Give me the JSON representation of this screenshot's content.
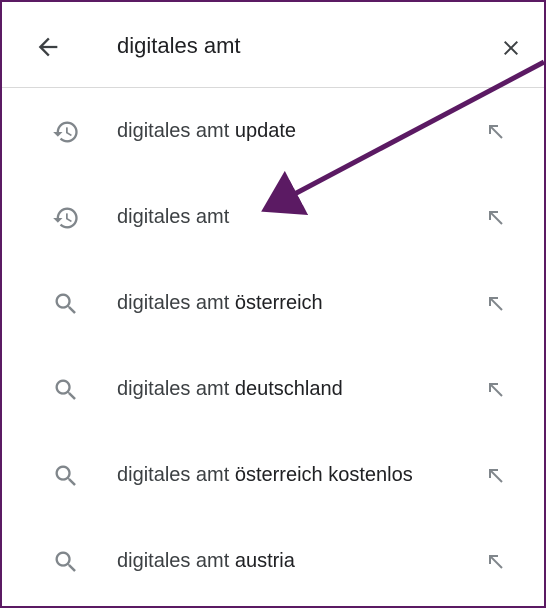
{
  "search": {
    "query": "digitales amt",
    "back_icon": "arrow-back-icon",
    "clear_icon": "close-icon"
  },
  "suggestions": [
    {
      "type": "history",
      "icon": "history-icon",
      "prefix": "digitales amt",
      "suffix": " update"
    },
    {
      "type": "history",
      "icon": "history-icon",
      "prefix": "digitales amt",
      "suffix": ""
    },
    {
      "type": "search",
      "icon": "search-icon",
      "prefix": "digitales amt",
      "suffix": " österreich"
    },
    {
      "type": "search",
      "icon": "search-icon",
      "prefix": "digitales amt",
      "suffix": " deutschland"
    },
    {
      "type": "search",
      "icon": "search-icon",
      "prefix": "digitales amt",
      "suffix": " österreich kostenlos"
    },
    {
      "type": "search",
      "icon": "search-icon",
      "prefix": "digitales amt",
      "suffix": " austria"
    }
  ],
  "colors": {
    "annotation_arrow": "#5b1a63",
    "frame_border": "#5b1a63",
    "icon_gray": "#80868b",
    "text_dark": "#202124"
  }
}
